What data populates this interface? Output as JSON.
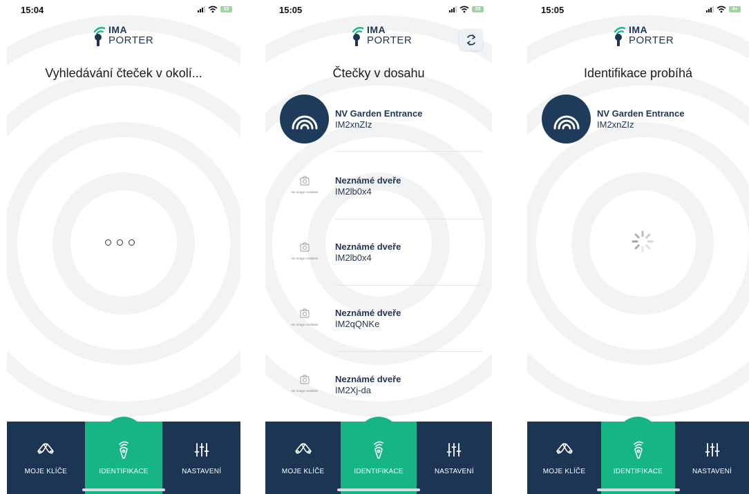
{
  "colors": {
    "navy": "#1b3553",
    "green": "#15b584",
    "text_dark": "#1e3553"
  },
  "screens": [
    {
      "status_time": "15:04",
      "battery": "33",
      "logo": {
        "top": "IMA",
        "bottom": "PORTER"
      },
      "title": "Vyhledávání čteček v okolí...",
      "state": "searching-dots"
    },
    {
      "status_time": "15:05",
      "battery": "33",
      "logo": {
        "top": "IMA",
        "bottom": "PORTER"
      },
      "title": "Čtečky v dosahu",
      "refresh_icon": "refresh-icon",
      "readers": [
        {
          "name": "NV Garden Entrance",
          "id": "IM2xnZIz",
          "image": "reader-waves-icon"
        },
        {
          "name": "Neznámé dveře",
          "id": "IM2lb0x4",
          "image": "no-image-available",
          "image_label": "No Image Available"
        },
        {
          "name": "Neznámé dveře",
          "id": "IM2lb0x4",
          "image": "no-image-available",
          "image_label": "No Image Available"
        },
        {
          "name": "Neznámé dveře",
          "id": "IM2qQNKe",
          "image": "no-image-available",
          "image_label": "No Image Available"
        },
        {
          "name": "Neznámé dveře",
          "id": "IM2Xj-da",
          "image": "no-image-available",
          "image_label": "No Image Available"
        }
      ]
    },
    {
      "status_time": "15:05",
      "battery": "4+",
      "logo": {
        "top": "IMA",
        "bottom": "PORTER"
      },
      "title": "Identifikace probíhá",
      "readers": [
        {
          "name": "NV Garden Entrance",
          "id": "IM2xnZIz",
          "image": "reader-waves-icon"
        }
      ],
      "state": "loading-spinner"
    }
  ],
  "tabbar": {
    "items": [
      {
        "label": "MOJE KLÍČE",
        "icon": "keys-icon",
        "active": false
      },
      {
        "label": "IDENTIFIKACE",
        "icon": "key-fob-icon",
        "active": true
      },
      {
        "label": "NASTAVENÍ",
        "icon": "sliders-icon",
        "active": false
      }
    ]
  }
}
